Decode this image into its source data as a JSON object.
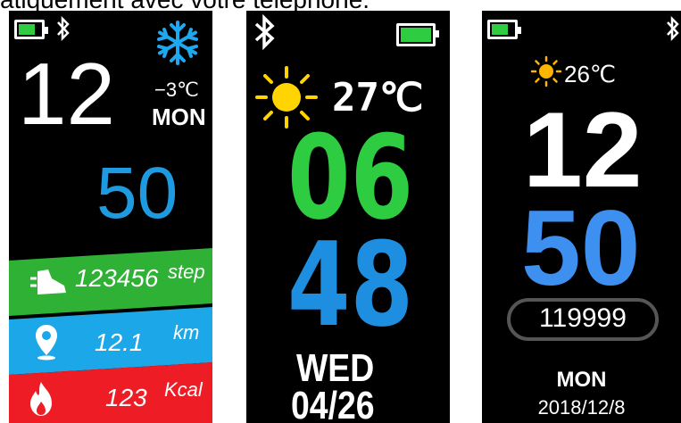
{
  "caption": "atiquement avec votre téléphone.",
  "screen1": {
    "battery_icon": "battery-icon",
    "bt_icon": "bluetooth-icon",
    "weather_icon": "snowflake-icon",
    "hour": "12",
    "temp": "−3℃",
    "day": "MON",
    "minute": "50",
    "steps_value": "123456",
    "steps_unit": "step",
    "distance_value": "12.1",
    "distance_unit": "km",
    "calories_value": "123",
    "calories_unit": "Kcal",
    "colors": {
      "green": "#2eb135",
      "blue": "#1ba7e8",
      "red": "#ee1c24",
      "minute": "#1e9be0",
      "snow": "#1ea8f0"
    }
  },
  "screen2": {
    "bt_icon": "bluetooth-icon",
    "battery_icon": "battery-icon",
    "weather_icon": "sun-icon",
    "temp": "27℃",
    "hour": "06",
    "minute": "48",
    "day": "WED",
    "date": "04/26",
    "colors": {
      "hour": "#2ecc40",
      "minute": "#1e8fe0",
      "sun": "#ffd400"
    }
  },
  "screen3": {
    "battery_icon": "battery-icon",
    "bt_icon": "bluetooth-icon",
    "weather_icon": "sun-icon",
    "temp": "26℃",
    "hour": "12",
    "minute": "50",
    "steps": "119999",
    "day": "MON",
    "date": "2018/12/8",
    "colors": {
      "minute": "#3d8ff0",
      "sun": "#ffb400"
    }
  }
}
